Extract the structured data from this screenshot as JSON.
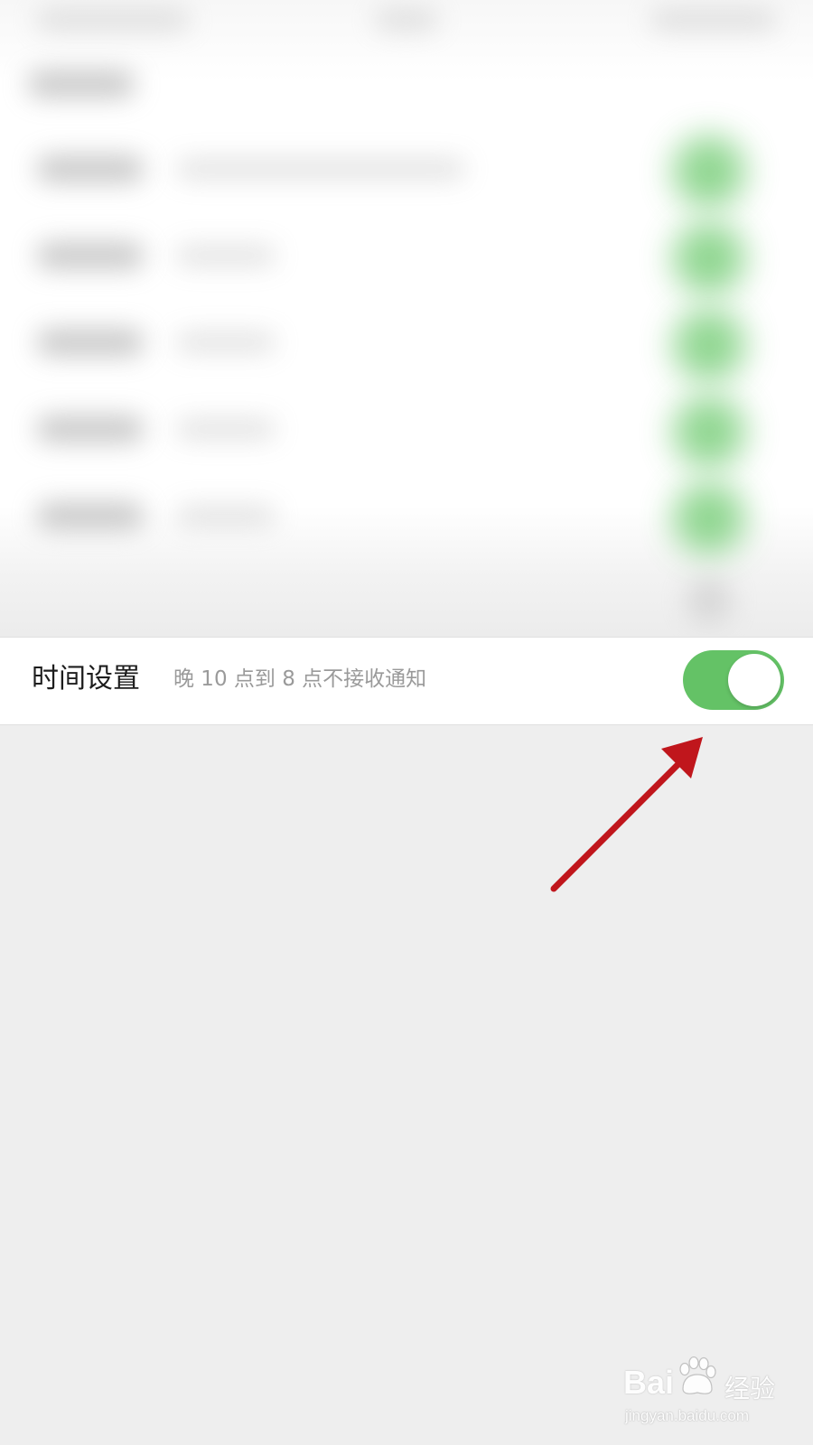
{
  "setting": {
    "title": "时间设置",
    "description": "晚 10 点到 8 点不接收通知",
    "toggle_on": true
  },
  "colors": {
    "toggle_on": "#64c266",
    "arrow": "#c0161c",
    "page_background": "#eeeeee"
  },
  "watermark": {
    "brand_left": "Bai",
    "brand_right": "经验",
    "url": "jingyan.baidu.com"
  }
}
